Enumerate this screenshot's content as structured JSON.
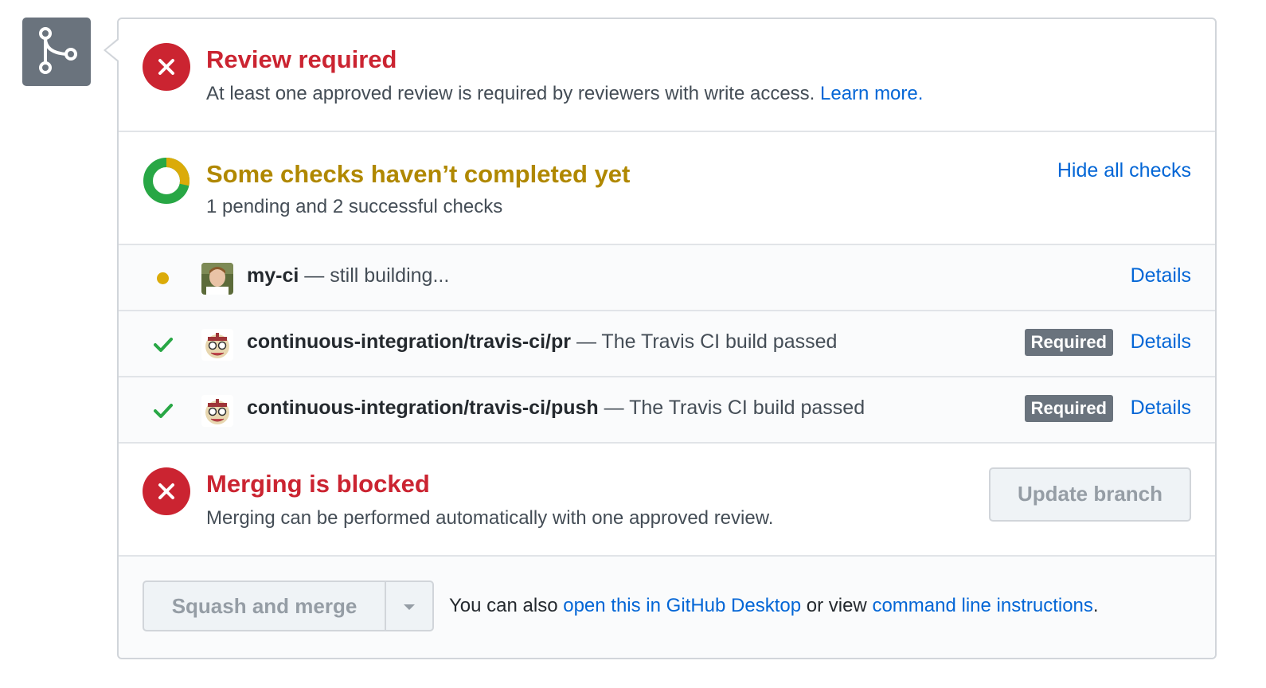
{
  "icon": "git-merge-icon",
  "colors": {
    "red": "#cb2431",
    "yellow": "#b08800",
    "green": "#28a745",
    "pending": "#dbab09",
    "link": "#0366d6",
    "badge": "#6a737d"
  },
  "review": {
    "title": "Review required",
    "description": "At least one approved review is required by reviewers with write access.",
    "learn_more": "Learn more."
  },
  "checks_summary": {
    "title": "Some checks haven’t completed yet",
    "subtitle": "1 pending and 2 successful checks",
    "toggle_label": "Hide all checks"
  },
  "checks": [
    {
      "status": "pending",
      "name": "my-ci",
      "description": "— still building...",
      "required": "",
      "details": "Details"
    },
    {
      "status": "success",
      "name": "continuous-integration/travis-ci/pr",
      "description": "— The Travis CI build passed",
      "required": "Required",
      "details": "Details"
    },
    {
      "status": "success",
      "name": "continuous-integration/travis-ci/push",
      "description": "— The Travis CI build passed",
      "required": "Required",
      "details": "Details"
    }
  ],
  "blocked": {
    "title": "Merging is blocked",
    "description": "Merging can be performed automatically with one approved review.",
    "update_button": "Update branch"
  },
  "merge": {
    "button": "Squash and merge",
    "note_prefix": "You can also",
    "desktop_link": "open this in GitHub Desktop",
    "note_middle": "or view",
    "cli_link": "command line instructions",
    "note_suffix": "."
  }
}
